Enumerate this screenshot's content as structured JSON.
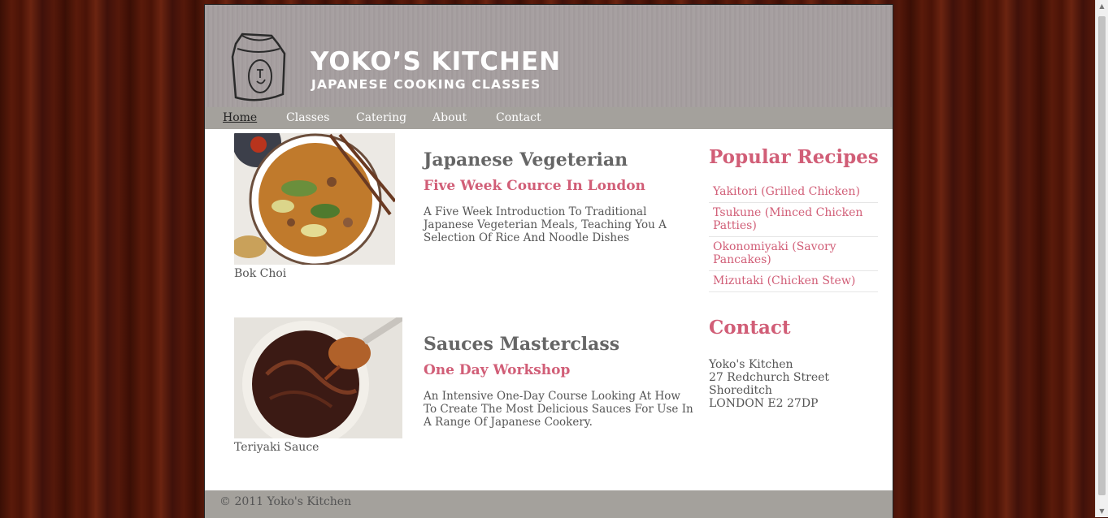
{
  "brand": {
    "title": "YOKO’S KITCHEN",
    "subtitle": "JAPANESE COOKING CLASSES"
  },
  "nav": {
    "items": [
      "Home",
      "Classes",
      "Catering",
      "About",
      "Contact"
    ],
    "active": "Home"
  },
  "articles": [
    {
      "caption": "Bok Choi",
      "title": "Japanese Vegeterian",
      "subtitle": "Five Week Cource In London",
      "description": "A Five Week Introduction To Traditional Japanese Vegeterian Meals, Teaching You A Selection Of Rice And Noodle Dishes"
    },
    {
      "caption": "Teriyaki Sauce",
      "title": "Sauces Masterclass",
      "subtitle": "One Day Workshop",
      "description": "An Intensive One-Day Course Looking At How To Create The Most Delicious Sauces For Use In A Range Of Japanese Cookery."
    }
  ],
  "sidebar": {
    "recipes_title": "Popular Recipes",
    "recipes": [
      "Yakitori (Grilled Chicken)",
      "Tsukune (Minced Chicken Patties)",
      "Okonomiyaki (Savory Pancakes)",
      "Mizutaki (Chicken Stew)"
    ],
    "contact_title": "Contact",
    "contact_lines": [
      "Yoko's Kitchen",
      "27 Redchurch Street",
      "Shoreditch",
      "LONDON E2 27DP"
    ]
  },
  "footer": {
    "text": "© 2011 Yoko's Kitchen"
  },
  "colors": {
    "accent": "#d15e77",
    "header_bg": "#a49d9e",
    "nav_bg": "#a4a19c",
    "heading": "#666666"
  }
}
